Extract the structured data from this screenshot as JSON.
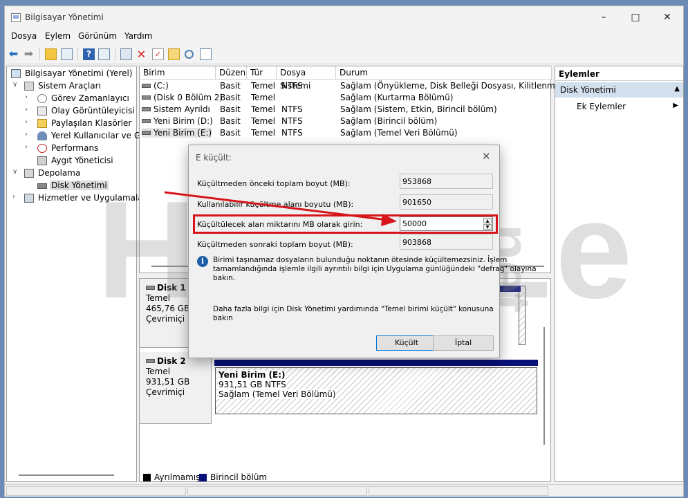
{
  "window": {
    "title": "Bilgisayar Yönetimi",
    "controls": {
      "minimize": "–",
      "maximize": "□",
      "close": "✕"
    }
  },
  "menu": [
    "Dosya",
    "Eylem",
    "Görünüm",
    "Yardım"
  ],
  "toolbar_icons": [
    "back-arrow-icon",
    "forward-arrow-icon",
    "up-folder-icon",
    "show-hide-tree-icon",
    "help-icon",
    "properties-icon",
    "connect-icon",
    "delete-icon",
    "check-icon",
    "import-icon",
    "search-icon",
    "list-icon"
  ],
  "tree": {
    "root": "Bilgisayar Yönetimi (Yerel)",
    "system_tools": "Sistem Araçları",
    "task_scheduler": "Görev Zamanlayıcı",
    "event_viewer": "Olay Görüntüleyicisi",
    "shared_folders": "Paylaşılan Klasörler",
    "local_users": "Yerel Kullanıcılar ve Gru",
    "performance": "Performans",
    "device_manager": "Aygıt Yöneticisi",
    "storage": "Depolama",
    "disk_management": "Disk Yönetimi",
    "services": "Hizmetler ve Uygulamalar"
  },
  "volume_table": {
    "columns": [
      "Birim",
      "Düzen",
      "Tür",
      "Dosya Sistemi",
      "Durum"
    ],
    "rows": [
      [
        "(C:)",
        "Basit",
        "Temel",
        "NTFS",
        "Sağlam (Önyükleme, Disk Belleği Dosyası, Kilitlenme Bilgisi"
      ],
      [
        "(Disk 0 Bölüm 2)",
        "Basit",
        "Temel",
        "",
        "Sağlam (Kurtarma Bölümü)"
      ],
      [
        "Sistem Ayrıldı",
        "Basit",
        "Temel",
        "NTFS",
        "Sağlam (Sistem, Etkin, Birincil bölüm)"
      ],
      [
        "Yeni Birim (D:)",
        "Basit",
        "Temel",
        "NTFS",
        "Sağlam (Birincil bölüm)"
      ],
      [
        "Yeni Birim (E:)",
        "Basit",
        "Temel",
        "NTFS",
        "Sağlam (Temel Veri Bölümü)"
      ]
    ]
  },
  "disks": [
    {
      "name": "Disk 1",
      "type": "Temel",
      "size": "465,76 GB",
      "status": "Çevrimiçi"
    },
    {
      "name": "Disk 2",
      "type": "Temel",
      "size": "931,51 GB",
      "status": "Çevrimiçi"
    }
  ],
  "partition_e": {
    "name": "Yeni Birim  (E:)",
    "fs": "931,51 GB NTFS",
    "status": "Sağlam (Temel Veri Bölümü)"
  },
  "legend": [
    {
      "label": "Ayrılmamış",
      "color": "#000000"
    },
    {
      "label": "Birincil bölüm",
      "color": "#08107a"
    }
  ],
  "actions": {
    "header": "Eylemler",
    "section": "Disk Yönetimi",
    "more": "Ek Eylemler"
  },
  "dialog": {
    "title": "E küçült:",
    "total_before_label": "Küçültmeden önceki toplam boyut (MB):",
    "total_before_value": "953868",
    "available_label": "Kullanılabilir küçültme alanı boyutu (MB):",
    "available_value": "901650",
    "amount_label": "Küçültülecek alan miktarını MB olarak girin:",
    "amount_value": "50000",
    "total_after_label": "Küçültmeden sonraki toplam boyut (MB):",
    "total_after_value": "903868",
    "info_line1": "Birimi taşınamaz dosyaların bulunduğu noktanın ötesinde küçültemezsiniz. İşlem",
    "info_line2": "tamamlandığında işlemle ilgili ayrıntılı bilgi için Uygulama günlüğündeki \"defrag\" olayına",
    "info_line3": "bakın.",
    "help_line1": "Daha fazla bilgi için Disk Yönetimi yardımında \"Temel birimi küçült\" konusuna",
    "help_line2": "bakın",
    "shrink_button": "Küçült",
    "cancel_button": "İptal"
  },
  "watermark": {
    "main": "HodoLe",
    "suffix": ".net"
  },
  "colors": {
    "annotation_red": "#d5141b",
    "selection_blue": "#d2dfec",
    "primary_partition": "#08107a"
  }
}
